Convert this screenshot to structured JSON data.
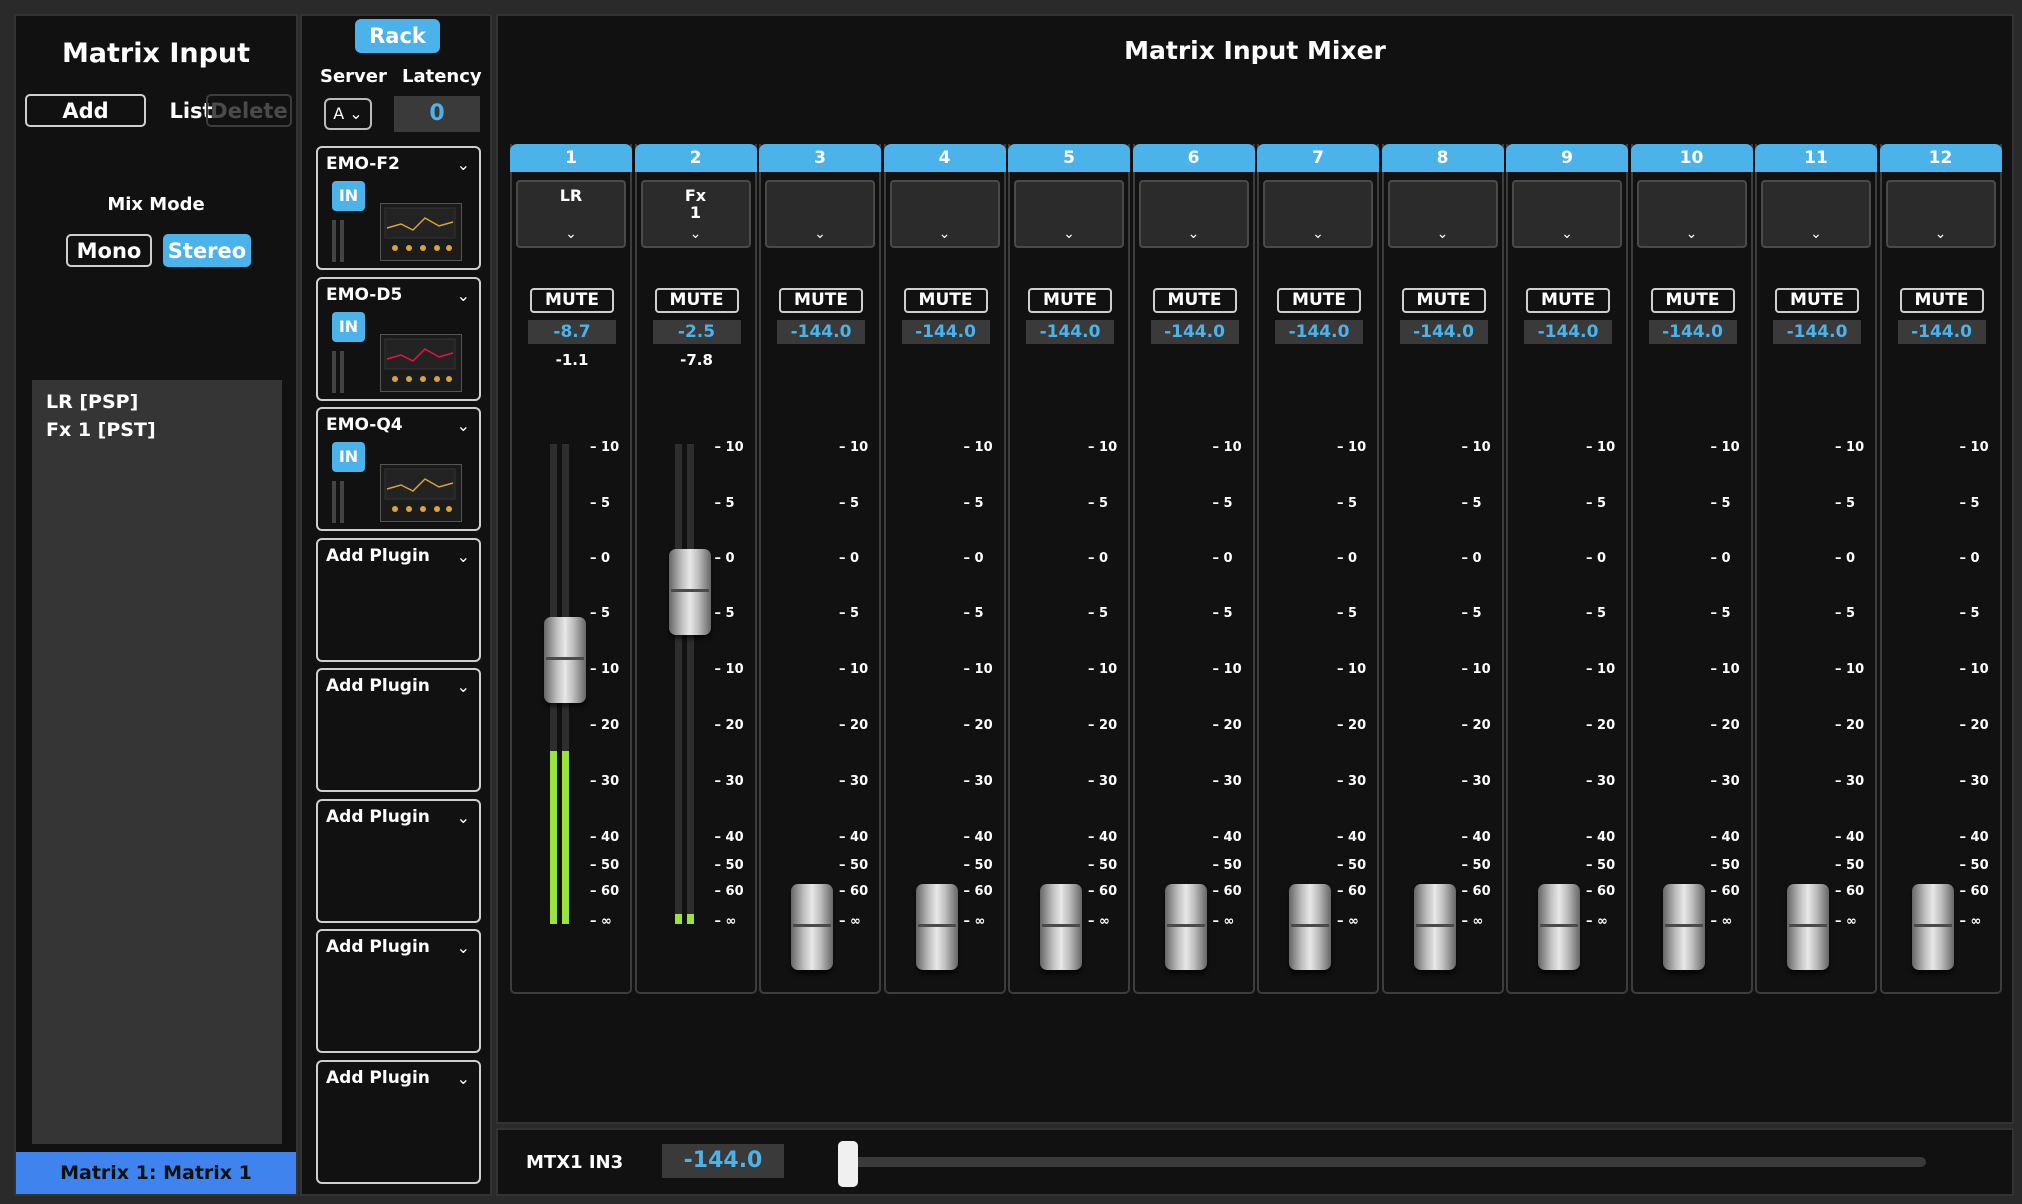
{
  "left": {
    "title": "Matrix Input",
    "add_label": "Add",
    "list_label": "List",
    "delete_label": "Delete",
    "mix_mode_label": "Mix Mode",
    "mono_label": "Mono",
    "stereo_label": "Stereo",
    "mix_mode_selected": "Stereo",
    "items": [
      "LR [PSP]",
      "Fx 1 [PST]"
    ],
    "footer": "Matrix 1: Matrix 1"
  },
  "rack": {
    "rack_label": "Rack",
    "server_label": "Server",
    "latency_label": "Latency",
    "server_value": "A",
    "latency_value": "0",
    "plugins": [
      {
        "name": "EMO-F2",
        "in_label": "IN",
        "thumb_icon": "eq-plugin-thumbnail"
      },
      {
        "name": "EMO-D5",
        "in_label": "IN",
        "thumb_icon": "dynamics-plugin-thumbnail"
      },
      {
        "name": "EMO-Q4",
        "in_label": "IN",
        "thumb_icon": "eq-curve-plugin-thumbnail"
      },
      {
        "name": "Add Plugin"
      },
      {
        "name": "Add Plugin"
      },
      {
        "name": "Add Plugin"
      },
      {
        "name": "Add Plugin"
      },
      {
        "name": "Add Plugin"
      }
    ]
  },
  "mixer": {
    "title": "Matrix Input Mixer",
    "mute_label": "MUTE",
    "scale_labels": [
      "10",
      "5",
      "0",
      "5",
      "10",
      "20",
      "30",
      "40",
      "50",
      "60",
      "∞"
    ],
    "channels": [
      {
        "num": "1",
        "route": "LR",
        "route_sub": "",
        "gain": "-8.7",
        "trim": "-1.1",
        "fader_db": -8.7,
        "meter_level": 0.36
      },
      {
        "num": "2",
        "route": "Fx",
        "route_sub": "1",
        "gain": "-2.5",
        "trim": "-7.8",
        "meter_level": 0.02,
        "fader_db": -2.5
      },
      {
        "num": "3",
        "route": "",
        "route_sub": "",
        "gain": "-144.0",
        "trim": "",
        "fader_db": -144.0,
        "meter_level": 0
      },
      {
        "num": "4",
        "route": "",
        "route_sub": "",
        "gain": "-144.0",
        "trim": "",
        "fader_db": -144.0,
        "meter_level": 0
      },
      {
        "num": "5",
        "route": "",
        "route_sub": "",
        "gain": "-144.0",
        "trim": "",
        "fader_db": -144.0,
        "meter_level": 0
      },
      {
        "num": "6",
        "route": "",
        "route_sub": "",
        "gain": "-144.0",
        "trim": "",
        "fader_db": -144.0,
        "meter_level": 0
      },
      {
        "num": "7",
        "route": "",
        "route_sub": "",
        "gain": "-144.0",
        "trim": "",
        "fader_db": -144.0,
        "meter_level": 0
      },
      {
        "num": "8",
        "route": "",
        "route_sub": "",
        "gain": "-144.0",
        "trim": "",
        "fader_db": -144.0,
        "meter_level": 0
      },
      {
        "num": "9",
        "route": "",
        "route_sub": "",
        "gain": "-144.0",
        "trim": "",
        "fader_db": -144.0,
        "meter_level": 0
      },
      {
        "num": "10",
        "route": "",
        "route_sub": "",
        "gain": "-144.0",
        "trim": "",
        "fader_db": -144.0,
        "meter_level": 0
      },
      {
        "num": "11",
        "route": "",
        "route_sub": "",
        "gain": "-144.0",
        "trim": "",
        "fader_db": -144.0,
        "meter_level": 0
      },
      {
        "num": "12",
        "route": "",
        "route_sub": "",
        "gain": "-144.0",
        "trim": "",
        "fader_db": -144.0,
        "meter_level": 0
      }
    ]
  },
  "bottom": {
    "label": "MTX1 IN3",
    "value": "-144.0",
    "slider_level": 0
  },
  "colors": {
    "accent": "#4cb2ea",
    "footer": "#3f84ee",
    "meter": "#9be33a",
    "panel": "#111111"
  }
}
